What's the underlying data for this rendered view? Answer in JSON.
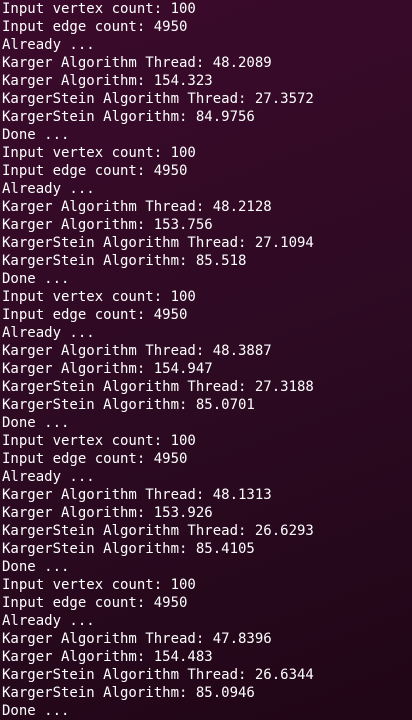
{
  "terminal": {
    "lines": [
      "Input vertex count: 100",
      "Input edge count: 4950",
      "Already ...",
      "Karger Algorithm Thread: 48.2089",
      "Karger Algorithm: 154.323",
      "KargerStein Algorithm Thread: 27.3572",
      "KargerStein Algorithm: 84.9756",
      "Done ...",
      "Input vertex count: 100",
      "Input edge count: 4950",
      "Already ...",
      "Karger Algorithm Thread: 48.2128",
      "Karger Algorithm: 153.756",
      "KargerStein Algorithm Thread: 27.1094",
      "KargerStein Algorithm: 85.518",
      "Done ...",
      "Input vertex count: 100",
      "Input edge count: 4950",
      "Already ...",
      "Karger Algorithm Thread: 48.3887",
      "Karger Algorithm: 154.947",
      "KargerStein Algorithm Thread: 27.3188",
      "KargerStein Algorithm: 85.0701",
      "Done ...",
      "Input vertex count: 100",
      "Input edge count: 4950",
      "Already ...",
      "Karger Algorithm Thread: 48.1313",
      "Karger Algorithm: 153.926",
      "KargerStein Algorithm Thread: 26.6293",
      "KargerStein Algorithm: 85.4105",
      "Done ...",
      "Input vertex count: 100",
      "Input edge count: 4950",
      "Already ...",
      "Karger Algorithm Thread: 47.8396",
      "Karger Algorithm: 154.483",
      "KargerStein Algorithm Thread: 26.6344",
      "KargerStein Algorithm: 85.0946",
      "Done ..."
    ]
  }
}
